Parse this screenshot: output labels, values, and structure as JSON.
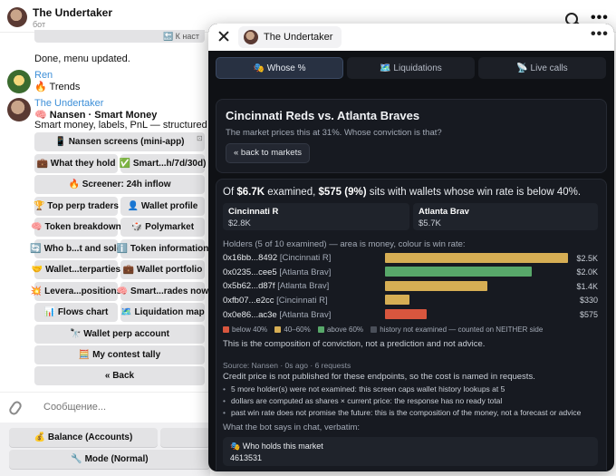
{
  "chat": {
    "title": "The Undertaker",
    "subtitle": "бот",
    "keyboard_top_label": "🔙 К наст",
    "done_message": "Done, menu updated.",
    "ren_name": "Ren",
    "ren_message": "🔥 Trends",
    "bot_name": "The Undertaker",
    "bot_title": "🧠 Nansen · Smart Money",
    "bot_desc": "Smart money, labels, PnL — structured (cheap).",
    "mini_app_glyph": "⊡",
    "keyboard": {
      "nansen_screens": "📱 Nansen screens (mini-app)",
      "what_they_hold": "💼 What they hold",
      "smart_flows": "✅ Smart...h/7d/30d)",
      "screener": "🔥 Screener: 24h inflow",
      "top_perp": "🏆 Top perp traders",
      "wallet_profile": "👤 Wallet profile",
      "token_breakdown": "🧠 Token breakdown",
      "polymarket": "🎲 Polymarket",
      "who_bought": "🔄 Who b...t and sold",
      "token_info": "ℹ️ Token information",
      "wallet_counterparties": "🤝 Wallet...terparties",
      "wallet_portfolio": "💼 Wallet portfolio",
      "leverage_positions": "💥 Levera...positions",
      "smart_trades": "🧠 Smart...rades now",
      "flows_chart": "📊 Flows chart",
      "liquidation_map": "🗺️ Liquidation map",
      "wallet_perp": "🔭 Wallet perp account",
      "contest_tally": "🧮 My contest tally",
      "back": "« Back"
    },
    "composer_placeholder": "Сообщение...",
    "reply": {
      "balance": "💰 Balance (Accounts)",
      "mode": "🔧 Mode (Normal)"
    }
  },
  "mini_app": {
    "title": "The Undertaker",
    "tabs": [
      "🎭 Whose %",
      "🗺️ Liquidations",
      "📡 Live calls"
    ],
    "match": {
      "title": "Cincinnati Reds vs. Atlanta Braves",
      "subtitle": "The market prices this at 31%. Whose conviction is that?",
      "back_label": "« back to markets"
    },
    "summary": {
      "prefix": "Of ",
      "examined_amount": "$6.7K",
      "mid": " examined, ",
      "below_amount": "$575 (9%)",
      "suffix": " sits with wallets whose win rate is below 40%."
    },
    "sides": [
      {
        "name": "Cincinnati R",
        "value": "$2.8K"
      },
      {
        "name": "Atlanta Brav",
        "value": "$5.7K"
      }
    ],
    "holders_caption": "Holders (5 of 10 examined) — area is money, colour is win rate:",
    "holders": [
      {
        "address": "0x16bb...8492",
        "side": "[Cincinnati R]",
        "value": "$2.5K",
        "share": 1.0,
        "color": "#d6ae54"
      },
      {
        "address": "0x0235...cee5",
        "side": "[Atlanta Brav]",
        "value": "$2.0K",
        "share": 0.8,
        "color": "#58a86a"
      },
      {
        "address": "0x5b62...d87f",
        "side": "[Atlanta Brav]",
        "value": "$1.4K",
        "share": 0.56,
        "color": "#d6ae54"
      },
      {
        "address": "0xfb07...e2cc",
        "side": "[Cincinnati R]",
        "value": "$330",
        "share": 0.132,
        "color": "#d6ae54"
      },
      {
        "address": "0x0e86...ac3e",
        "side": "[Atlanta Brav]",
        "value": "$575",
        "share": 0.23,
        "color": "#d8563e"
      }
    ],
    "legend": [
      {
        "label": "below 40%",
        "color": "#d8563e"
      },
      {
        "label": "40–60%",
        "color": "#d6ae54"
      },
      {
        "label": "above 60%",
        "color": "#58a86a"
      },
      {
        "label": "history not examined — counted on NEITHER side",
        "color": "#4a4f59"
      }
    ],
    "composition_note": "This is the composition of conviction, not a prediction and not advice.",
    "source": "Source: Nansen · 0s ago · 6 requests",
    "credit_note": "Credit price is not published for these endpoints, so the cost is named in requests.",
    "notes": [
      "5 more holder(s) were not examined: this screen caps wallet history lookups at 5",
      "dollars are computed as shares × current price: the response has no ready total",
      "past win rate does not promise the future: this is the composition of the money, not a forecast or advice"
    ],
    "verbatim_label": "What the bot says in chat, verbatim:",
    "quote_line1": "🎭 Who holds this market",
    "quote_line2": "4613531"
  }
}
